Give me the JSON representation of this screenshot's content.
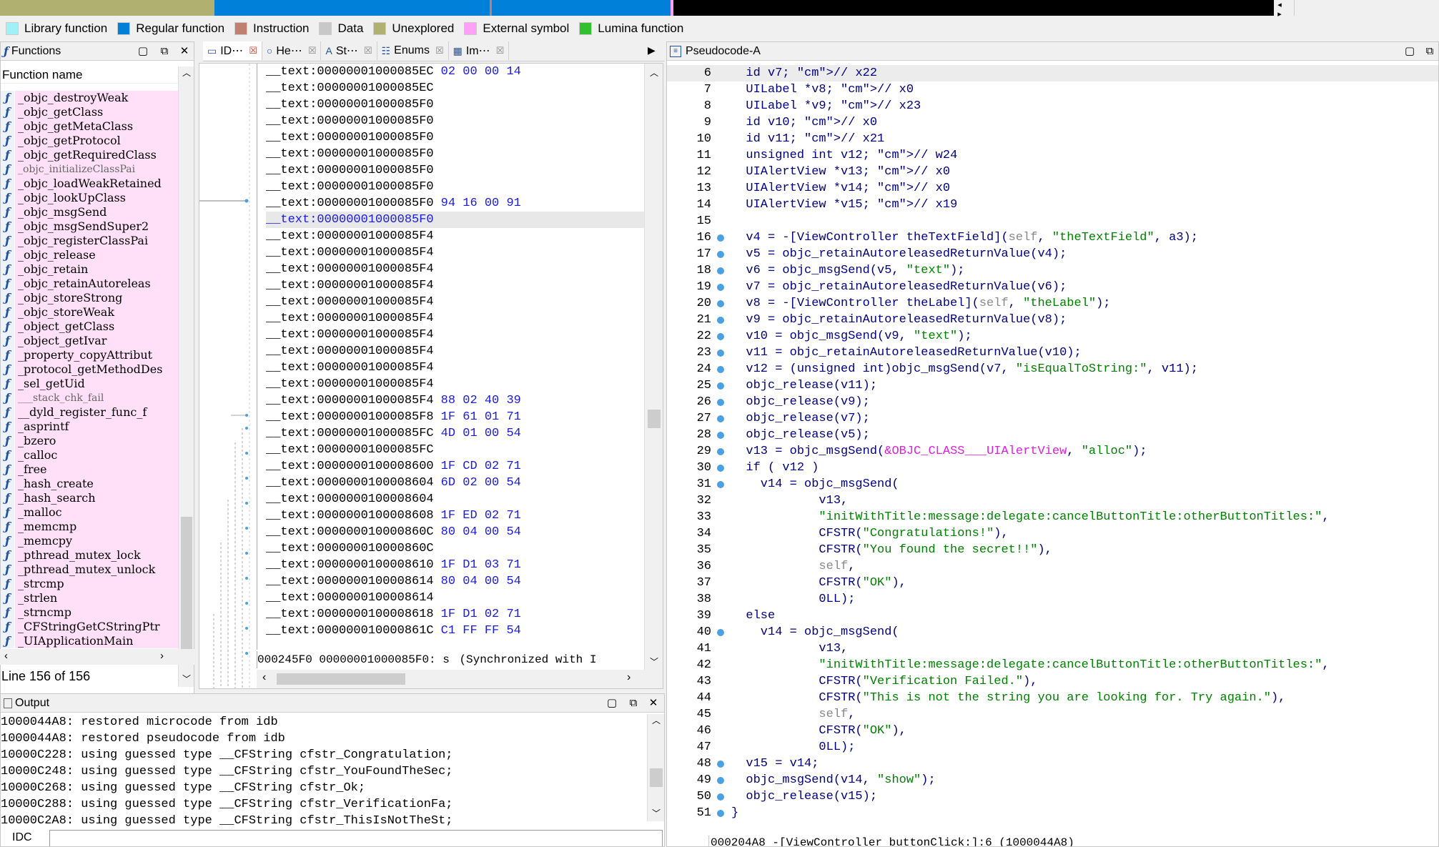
{
  "legend": [
    {
      "label": "Library function",
      "color": "#a0f0f8"
    },
    {
      "label": "Regular function",
      "color": "#0080d8"
    },
    {
      "label": "Instruction",
      "color": "#c08070"
    },
    {
      "label": "Data",
      "color": "#c8c8c8"
    },
    {
      "label": "Unexplored",
      "color": "#b0b070"
    },
    {
      "label": "External symbol",
      "color": "#ffa0f8"
    },
    {
      "label": "Lumina function",
      "color": "#30c030"
    }
  ],
  "functions_panel": {
    "title": "Functions",
    "column_header": "Function name",
    "status": "Line 156 of 156",
    "items": [
      "_objc_destroyWeak",
      "_objc_getClass",
      "_objc_getMetaClass",
      "_objc_getProtocol",
      "_objc_getRequiredClass",
      "_objc_initializeClassPai",
      "_objc_loadWeakRetained",
      "_objc_lookUpClass",
      "_objc_msgSend",
      "_objc_msgSendSuper2",
      "_objc_registerClassPai",
      "_objc_release",
      "_objc_retain",
      "_objc_retainAutoreleas",
      "_objc_storeStrong",
      "_objc_storeWeak",
      "_object_getClass",
      "_object_getIvar",
      "_property_copyAttribut",
      "_protocol_getMethodDes",
      "_sel_getUid",
      "___stack_chk_fail",
      "__dyld_register_func_f",
      "_asprintf",
      "_bzero",
      "_calloc",
      "_free",
      "_hash_create",
      "_hash_search",
      "_malloc",
      "_memcmp",
      "_memcpy",
      "_pthread_mutex_lock",
      "_pthread_mutex_unlock",
      "_strcmp",
      "_strlen",
      "_strncmp",
      "_CFStringGetCStringPtr",
      "_UIApplicationMain"
    ]
  },
  "tabs": [
    {
      "label": "ID⋯"
    },
    {
      "label": "He⋯"
    },
    {
      "label": "St⋯"
    },
    {
      "label": "Enums"
    },
    {
      "label": "Im⋯"
    }
  ],
  "disasm": {
    "rows": [
      {
        "addr": "__text:00000001000085EC",
        "bytes": "02 00 00 14"
      },
      {
        "addr": "__text:00000001000085EC",
        "bytes": ""
      },
      {
        "addr": "__text:00000001000085F0",
        "bytes": ""
      },
      {
        "addr": "__text:00000001000085F0",
        "bytes": ""
      },
      {
        "addr": "__text:00000001000085F0",
        "bytes": ""
      },
      {
        "addr": "__text:00000001000085F0",
        "bytes": ""
      },
      {
        "addr": "__text:00000001000085F0",
        "bytes": ""
      },
      {
        "addr": "__text:00000001000085F0",
        "bytes": ""
      },
      {
        "addr": "__text:00000001000085F0",
        "bytes": "94 16 00 91"
      },
      {
        "addr": "__text:00000001000085F0",
        "bytes": "",
        "selected": true
      },
      {
        "addr": "__text:00000001000085F4",
        "bytes": ""
      },
      {
        "addr": "__text:00000001000085F4",
        "bytes": ""
      },
      {
        "addr": "__text:00000001000085F4",
        "bytes": ""
      },
      {
        "addr": "__text:00000001000085F4",
        "bytes": ""
      },
      {
        "addr": "__text:00000001000085F4",
        "bytes": ""
      },
      {
        "addr": "__text:00000001000085F4",
        "bytes": ""
      },
      {
        "addr": "__text:00000001000085F4",
        "bytes": ""
      },
      {
        "addr": "__text:00000001000085F4",
        "bytes": ""
      },
      {
        "addr": "__text:00000001000085F4",
        "bytes": ""
      },
      {
        "addr": "__text:00000001000085F4",
        "bytes": ""
      },
      {
        "addr": "__text:00000001000085F4",
        "bytes": "88 02 40 39"
      },
      {
        "addr": "__text:00000001000085F8",
        "bytes": "1F 61 01 71"
      },
      {
        "addr": "__text:00000001000085FC",
        "bytes": "4D 01 00 54"
      },
      {
        "addr": "__text:00000001000085FC",
        "bytes": ""
      },
      {
        "addr": "__text:0000000100008600",
        "bytes": "1F CD 02 71"
      },
      {
        "addr": "__text:0000000100008604",
        "bytes": "6D 02 00 54"
      },
      {
        "addr": "__text:0000000100008604",
        "bytes": ""
      },
      {
        "addr": "__text:0000000100008608",
        "bytes": "1F ED 02 71"
      },
      {
        "addr": "__text:000000010000860C",
        "bytes": "80 04 00 54"
      },
      {
        "addr": "__text:000000010000860C",
        "bytes": ""
      },
      {
        "addr": "__text:0000000100008610",
        "bytes": "1F D1 03 71"
      },
      {
        "addr": "__text:0000000100008614",
        "bytes": "80 04 00 54"
      },
      {
        "addr": "__text:0000000100008614",
        "bytes": ""
      },
      {
        "addr": "__text:0000000100008618",
        "bytes": "1F D1 02 71"
      },
      {
        "addr": "__text:000000010000861C",
        "bytes": "C1 FF FF 54"
      }
    ],
    "status_left": "000245F0 00000001000085F0: s",
    "status_right": "(Synchronized with I"
  },
  "pseudocode": {
    "title": "Pseudocode-A",
    "status": "000204A8 -[ViewController buttonClick:]:6 (1000044A8)",
    "lines": [
      {
        "n": "6",
        "dot": false,
        "text": "  id v7; // x22"
      },
      {
        "n": "7",
        "dot": false,
        "text": "  UILabel *v8; // x0"
      },
      {
        "n": "8",
        "dot": false,
        "text": "  UILabel *v9; // x23"
      },
      {
        "n": "9",
        "dot": false,
        "text": "  id v10; // x0"
      },
      {
        "n": "10",
        "dot": false,
        "text": "  id v11; // x21"
      },
      {
        "n": "11",
        "dot": false,
        "text": "  unsigned int v12; // w24"
      },
      {
        "n": "12",
        "dot": false,
        "text": "  UIAlertView *v13; // x0"
      },
      {
        "n": "13",
        "dot": false,
        "text": "  UIAlertView *v14; // x0"
      },
      {
        "n": "14",
        "dot": false,
        "text": "  UIAlertView *v15; // x19"
      },
      {
        "n": "15",
        "dot": false,
        "text": ""
      },
      {
        "n": "16",
        "dot": true,
        "text": "  v4 = -[ViewController theTextField](self, \"theTextField\", a3);"
      },
      {
        "n": "17",
        "dot": true,
        "text": "  v5 = objc_retainAutoreleasedReturnValue(v4);"
      },
      {
        "n": "18",
        "dot": true,
        "text": "  v6 = objc_msgSend(v5, \"text\");"
      },
      {
        "n": "19",
        "dot": true,
        "text": "  v7 = objc_retainAutoreleasedReturnValue(v6);"
      },
      {
        "n": "20",
        "dot": true,
        "text": "  v8 = -[ViewController theLabel](self, \"theLabel\");"
      },
      {
        "n": "21",
        "dot": true,
        "text": "  v9 = objc_retainAutoreleasedReturnValue(v8);"
      },
      {
        "n": "22",
        "dot": true,
        "text": "  v10 = objc_msgSend(v9, \"text\");"
      },
      {
        "n": "23",
        "dot": true,
        "text": "  v11 = objc_retainAutoreleasedReturnValue(v10);"
      },
      {
        "n": "24",
        "dot": true,
        "text": "  v12 = (unsigned int)objc_msgSend(v7, \"isEqualToString:\", v11);"
      },
      {
        "n": "25",
        "dot": true,
        "text": "  objc_release(v11);"
      },
      {
        "n": "26",
        "dot": true,
        "text": "  objc_release(v9);"
      },
      {
        "n": "27",
        "dot": true,
        "text": "  objc_release(v7);"
      },
      {
        "n": "28",
        "dot": true,
        "text": "  objc_release(v5);"
      },
      {
        "n": "29",
        "dot": true,
        "text": "  v13 = objc_msgSend(&OBJC_CLASS___UIAlertView, \"alloc\");"
      },
      {
        "n": "30",
        "dot": true,
        "text": "  if ( v12 )"
      },
      {
        "n": "31",
        "dot": true,
        "text": "    v14 = objc_msgSend("
      },
      {
        "n": "32",
        "dot": false,
        "text": "            v13,"
      },
      {
        "n": "33",
        "dot": false,
        "text": "            \"initWithTitle:message:delegate:cancelButtonTitle:otherButtonTitles:\","
      },
      {
        "n": "34",
        "dot": false,
        "text": "            CFSTR(\"Congratulations!\"),"
      },
      {
        "n": "35",
        "dot": false,
        "text": "            CFSTR(\"You found the secret!!\"),"
      },
      {
        "n": "36",
        "dot": false,
        "text": "            self,"
      },
      {
        "n": "37",
        "dot": false,
        "text": "            CFSTR(\"OK\"),"
      },
      {
        "n": "38",
        "dot": false,
        "text": "            0LL);"
      },
      {
        "n": "39",
        "dot": false,
        "text": "  else"
      },
      {
        "n": "40",
        "dot": true,
        "text": "    v14 = objc_msgSend("
      },
      {
        "n": "41",
        "dot": false,
        "text": "            v13,"
      },
      {
        "n": "42",
        "dot": false,
        "text": "            \"initWithTitle:message:delegate:cancelButtonTitle:otherButtonTitles:\","
      },
      {
        "n": "43",
        "dot": false,
        "text": "            CFSTR(\"Verification Failed.\"),"
      },
      {
        "n": "44",
        "dot": false,
        "text": "            CFSTR(\"This is not the string you are looking for. Try again.\"),"
      },
      {
        "n": "45",
        "dot": false,
        "text": "            self,"
      },
      {
        "n": "46",
        "dot": false,
        "text": "            CFSTR(\"OK\"),"
      },
      {
        "n": "47",
        "dot": false,
        "text": "            0LL);"
      },
      {
        "n": "48",
        "dot": true,
        "text": "  v15 = v14;"
      },
      {
        "n": "49",
        "dot": true,
        "text": "  objc_msgSend(v14, \"show\");"
      },
      {
        "n": "50",
        "dot": true,
        "text": "  objc_release(v15);"
      },
      {
        "n": "51",
        "dot": true,
        "text": "}"
      }
    ]
  },
  "output": {
    "title": "Output",
    "lines": [
      "1000044A8: restored microcode from idb",
      "1000044A8: restored pseudocode from idb",
      "10000C228: using guessed type __CFString cfstr_Congratulation;",
      "10000C248: using guessed type __CFString cfstr_YouFoundTheSec;",
      "10000C268: using guessed type __CFString cfstr_Ok;",
      "10000C288: using guessed type __CFString cfstr_VerificationFa;",
      "10000C2A8: using guessed type __CFString cfstr_ThisIsNotTheSt;"
    ],
    "input_label": "IDC"
  }
}
